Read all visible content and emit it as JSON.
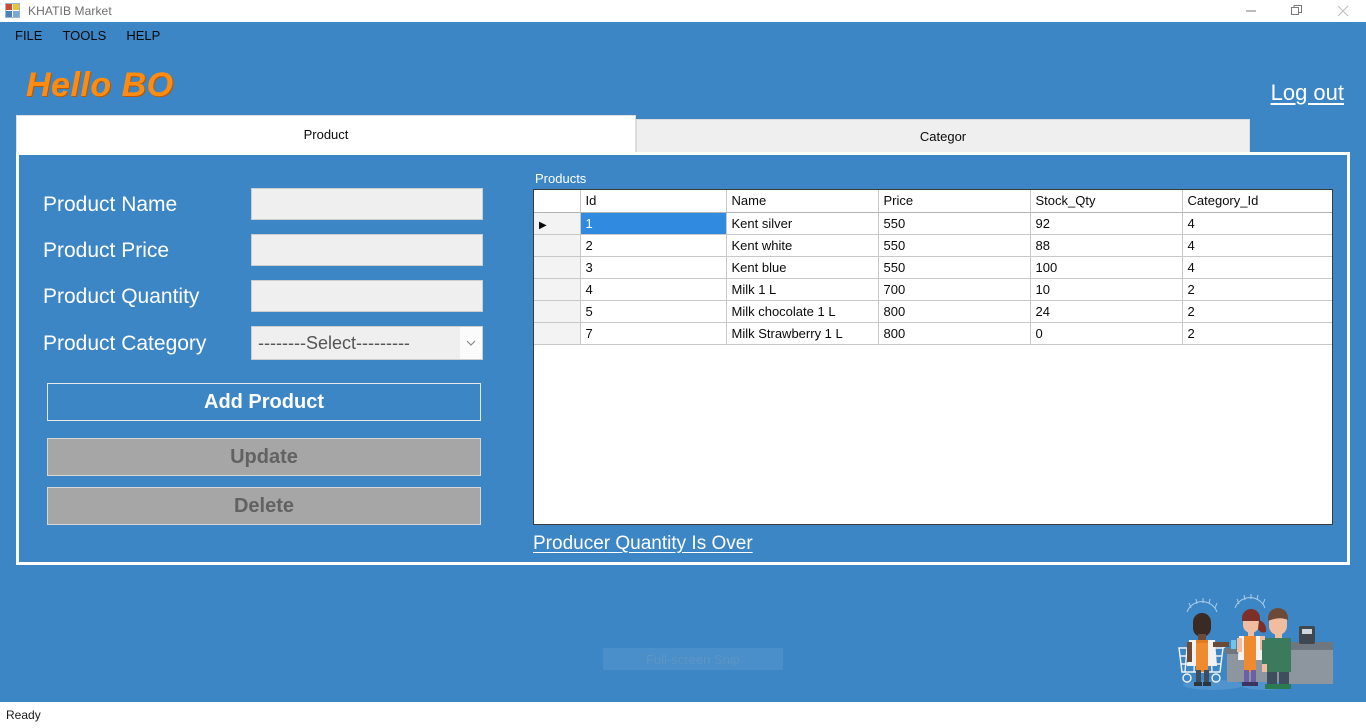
{
  "window": {
    "title": "KHATIB Market",
    "icon": "vb-form-icon",
    "controls": [
      {
        "name": "minimize-button",
        "glyph": "minimize-icon"
      },
      {
        "name": "restore-button",
        "glyph": "restore-icon"
      },
      {
        "name": "close-button",
        "glyph": "close-icon"
      }
    ]
  },
  "menubar": {
    "items": [
      {
        "label": "FILE"
      },
      {
        "label": "TOOLS"
      },
      {
        "label": "HELP"
      }
    ]
  },
  "header": {
    "greeting": "Hello BO",
    "greeting_color": "#ff8c11",
    "logout_label": "Log out"
  },
  "tabs": [
    {
      "label": "Product",
      "active": true
    },
    {
      "label": "Categor",
      "active": false
    }
  ],
  "form": {
    "fields": [
      {
        "label": "Product Name",
        "value": "",
        "placeholder": ""
      },
      {
        "label": "Product Price",
        "value": "",
        "placeholder": ""
      },
      {
        "label": "Product Quantity",
        "value": "",
        "placeholder": ""
      }
    ],
    "category": {
      "label": "Product Category",
      "selected": "--------Select---------",
      "arrow": "chevron-down-icon"
    },
    "buttons": [
      {
        "label": "Add Product",
        "enabled": true
      },
      {
        "label": "Update",
        "enabled": false
      },
      {
        "label": "Delete",
        "enabled": false
      }
    ]
  },
  "grid": {
    "caption": "Products",
    "columns": [
      "Id",
      "Name",
      "Price",
      "Stock_Qty",
      "Category_Id"
    ],
    "selected_row_index": 0,
    "rows": [
      {
        "Id": "1",
        "Name": "Kent silver",
        "Price": "550",
        "Stock_Qty": "92",
        "Category_Id": "4"
      },
      {
        "Id": "2",
        "Name": "Kent white",
        "Price": "550",
        "Stock_Qty": "88",
        "Category_Id": "4"
      },
      {
        "Id": "3",
        "Name": "Kent blue",
        "Price": "550",
        "Stock_Qty": "100",
        "Category_Id": "4"
      },
      {
        "Id": "4",
        "Name": "Milk 1 L",
        "Price": "700",
        "Stock_Qty": "10",
        "Category_Id": "2"
      },
      {
        "Id": "5",
        "Name": "Milk chocolate 1 L",
        "Price": "800",
        "Stock_Qty": "24",
        "Category_Id": "2"
      },
      {
        "Id": "7",
        "Name": "Milk Strawberry 1 L",
        "Price": "800",
        "Stock_Qty": "0",
        "Category_Id": "2"
      }
    ]
  },
  "links": {
    "producer_over": "Producer Quantity Is Over"
  },
  "overlay": {
    "snip_label": "Full-screen Snip"
  },
  "statusbar": {
    "text": "Ready"
  },
  "colors": {
    "app_blue": "#3d86c6",
    "accent_orange": "#ff8c11",
    "selection_blue": "#2f8ae0",
    "disabled_gray": "#a6a6a6"
  }
}
